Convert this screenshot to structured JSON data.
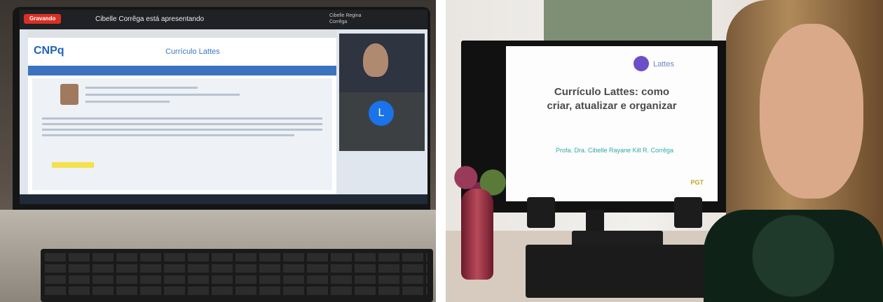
{
  "left_photo": {
    "meet_badge": "Gravando",
    "meet_title": "Cibelle Corrêga está apresentando",
    "meet_user": "Cibelle Regina Corrêga",
    "site_logo": "CNPq",
    "site_product": "Currículo Lattes",
    "presenter_avatar_letter": "L"
  },
  "right_photo": {
    "slide_logo_text": "Lattes",
    "slide_title_line1": "Currículo Lattes: como",
    "slide_title_line2": "criar, atualizar e organizar",
    "slide_author": "Profa. Dra. Cibelle Rayane Kill R. Corrêga",
    "slide_footer": "PGT"
  }
}
